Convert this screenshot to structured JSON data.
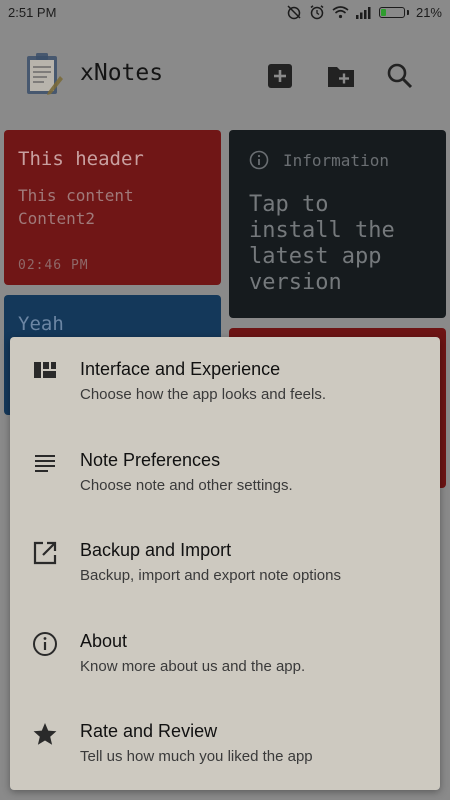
{
  "status": {
    "time": "2:51 PM",
    "battery_level": 0.21,
    "battery_text": "21%"
  },
  "app": {
    "title": "xNotes"
  },
  "notes": [
    {
      "title": "This header",
      "lines": [
        "This content",
        "Content2"
      ],
      "time": "02:46 PM"
    },
    {
      "info_label": "Information",
      "body": "Tap to install the latest app version"
    },
    {
      "title": "Yeah"
    }
  ],
  "menu": {
    "items": [
      {
        "icon": "dashboard-icon",
        "title": "Interface and Experience",
        "subtitle": "Choose how the app looks and feels."
      },
      {
        "icon": "notes-icon",
        "title": "Note Preferences",
        "subtitle": "Choose note and other settings."
      },
      {
        "icon": "open-external-icon",
        "title": "Backup and Import",
        "subtitle": "Backup, import and export note options"
      },
      {
        "icon": "info-icon",
        "title": "About",
        "subtitle": "Know more about us and the app."
      },
      {
        "icon": "star-icon",
        "title": "Rate and Review",
        "subtitle": "Tell us how much you liked the app"
      }
    ]
  }
}
